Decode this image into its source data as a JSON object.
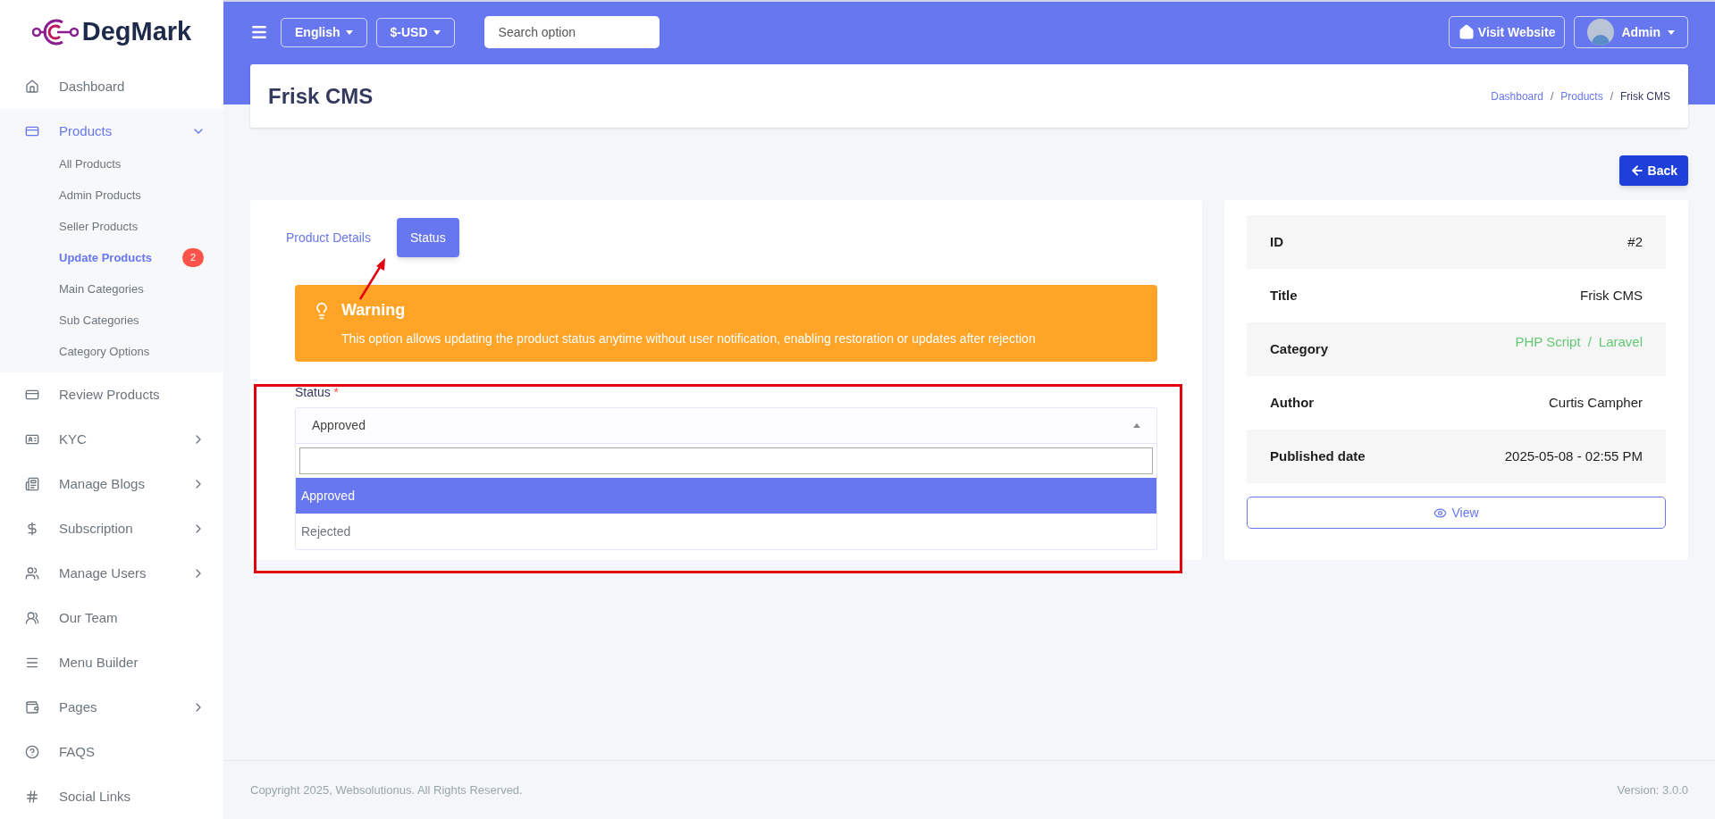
{
  "brand": {
    "name": "DegMark"
  },
  "sidebar": {
    "items": [
      {
        "label": "Dashboard",
        "selected": false,
        "expandable": false
      },
      {
        "label": "Products",
        "selected": true,
        "expandable": true,
        "expanded": true,
        "children": [
          {
            "label": "All Products",
            "selected": false
          },
          {
            "label": "Admin Products",
            "selected": false
          },
          {
            "label": "Seller Products",
            "selected": false
          },
          {
            "label": "Update Products",
            "selected": true,
            "badge": "2"
          },
          {
            "label": "Main Categories",
            "selected": false
          },
          {
            "label": "Sub Categories",
            "selected": false
          },
          {
            "label": "Category Options",
            "selected": false
          }
        ]
      },
      {
        "label": "Review Products",
        "selected": false,
        "expandable": false
      },
      {
        "label": "KYC",
        "selected": false,
        "expandable": true,
        "expanded": false
      },
      {
        "label": "Manage Blogs",
        "selected": false,
        "expandable": true,
        "expanded": false
      },
      {
        "label": "Subscription",
        "selected": false,
        "expandable": true,
        "expanded": false
      },
      {
        "label": "Manage Users",
        "selected": false,
        "expandable": true,
        "expanded": false
      },
      {
        "label": "Our Team",
        "selected": false,
        "expandable": false
      },
      {
        "label": "Menu Builder",
        "selected": false,
        "expandable": false
      },
      {
        "label": "Pages",
        "selected": false,
        "expandable": true,
        "expanded": false
      },
      {
        "label": "FAQS",
        "selected": false,
        "expandable": false
      },
      {
        "label": "Social Links",
        "selected": false,
        "expandable": false
      }
    ]
  },
  "topbar": {
    "language": "English",
    "currency": "$-USD",
    "search": {
      "placeholder": "Search option"
    },
    "visit_website": "Visit Website",
    "user": "Admin"
  },
  "page_header": {
    "title": "Frisk CMS",
    "separator": "/",
    "breadcrumbs": [
      {
        "label": "Dashboard",
        "link": true
      },
      {
        "label": "Products",
        "link": true
      },
      {
        "label": "Frisk CMS",
        "link": false
      }
    ]
  },
  "back_button": "Back",
  "tabs": [
    {
      "label": "Product Details",
      "selected": false
    },
    {
      "label": "Status",
      "selected": true
    }
  ],
  "warning": {
    "title": "Warning",
    "text": "This option allows updating the product status anytime without user notification, enabling restoration or updates after rejection"
  },
  "status_field": {
    "label": "Status",
    "required_mark": "*",
    "value": "Approved",
    "expanded": true,
    "options": [
      {
        "label": "Approved",
        "selected": true
      },
      {
        "label": "Rejected",
        "selected": false
      }
    ]
  },
  "details": [
    {
      "label": "ID",
      "value": "#2"
    },
    {
      "label": "Title",
      "value": "Frisk CMS"
    },
    {
      "label": "Category",
      "links": [
        "PHP Script",
        "Laravel"
      ],
      "separator": "/"
    },
    {
      "label": "Author",
      "value": "Curtis Campher"
    },
    {
      "label": "Published date",
      "value": "2025-05-08 - 02:55 PM"
    }
  ],
  "view_button": "View",
  "footer": {
    "copyright": "Copyright 2025, Websolutionus. All Rights Reserved.",
    "version": "Version: 3.0.0"
  }
}
